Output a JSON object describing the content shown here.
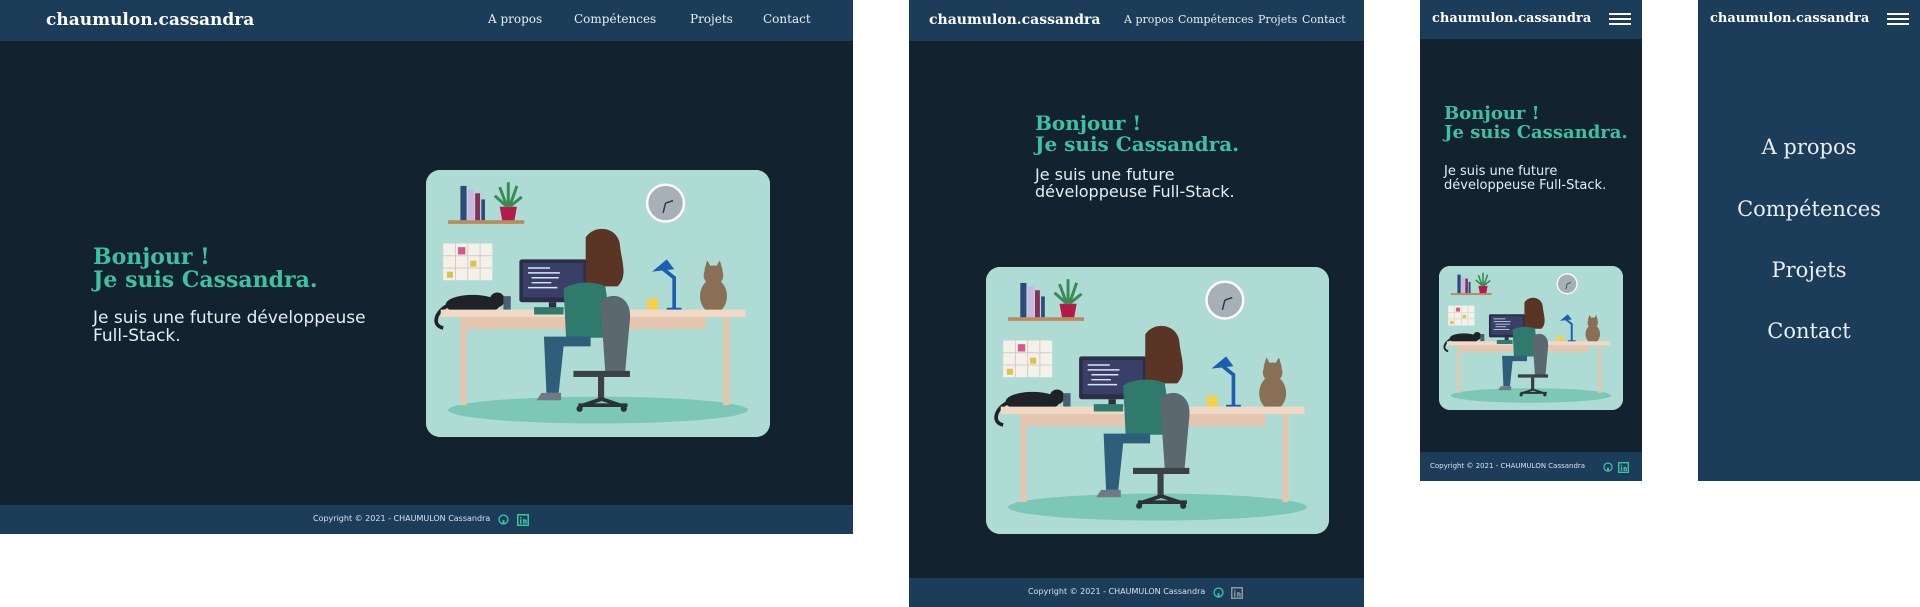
{
  "colors": {
    "background": "#13222f",
    "navbar": "#1c3d5a",
    "accent": "#3ec1a0",
    "illustration_bg": "#aedcd4"
  },
  "logo": "chaumulon.cassandra",
  "nav": {
    "about": "A propos",
    "skills": "Compétences",
    "projects": "Projets",
    "contact": "Contact"
  },
  "hero": {
    "greeting_line1": "Bonjour !",
    "greeting_line2": "Je suis Cassandra.",
    "intro_desktop_line1": "Je suis une future développeuse",
    "intro_desktop_line2": "Full-Stack.",
    "intro_line1": "Je suis une future",
    "intro_line2": "développeuse Full-Stack."
  },
  "footer": {
    "copyright": "Copyright © 2021 - CHAUMULON Cassandra"
  },
  "icons": {
    "github": "github-icon",
    "linkedin": "linkedin-icon",
    "menu": "hamburger-menu-icon"
  }
}
